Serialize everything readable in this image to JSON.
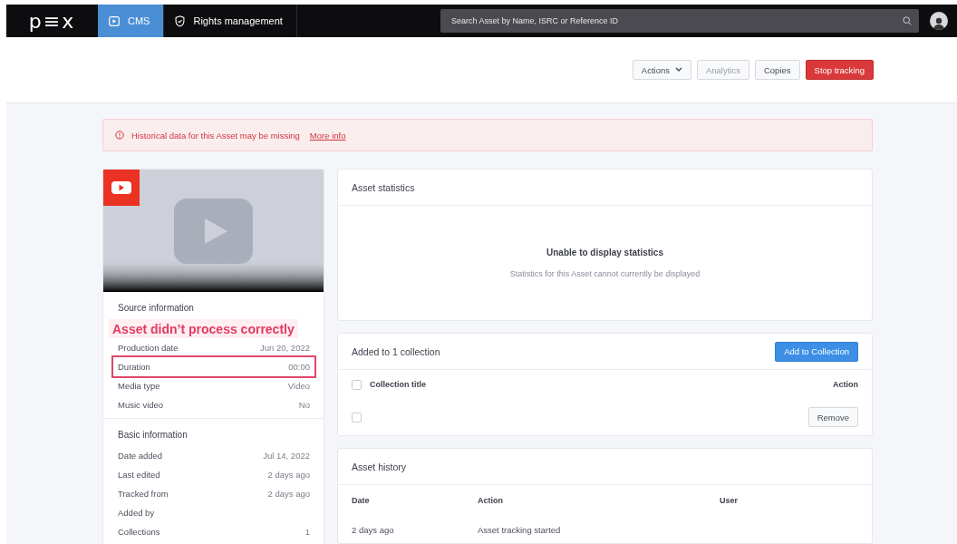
{
  "nav": {
    "logo": "p≡x",
    "tabs": [
      {
        "label": "CMS",
        "selected": true,
        "kind": "play"
      },
      {
        "label": "Rights management",
        "selected": false,
        "kind": "shield"
      }
    ],
    "search": {
      "placeholder": "Search Asset by Name, ISRC or Reference ID"
    }
  },
  "actions": [
    {
      "label": "Actions",
      "kind": "dropdown",
      "disabled": false
    },
    {
      "label": "Analytics",
      "kind": "default",
      "disabled": true
    },
    {
      "label": "Copies",
      "kind": "default",
      "disabled": false
    },
    {
      "label": "Stop tracking",
      "kind": "danger",
      "disabled": false
    }
  ],
  "alert": {
    "text": "Historical data for this Asset may be missing",
    "link": "More info"
  },
  "sections": [
    {
      "title": "Source information",
      "rows": [
        {
          "label": "Production date",
          "value": "Jun 20, 2022",
          "highlighted": false
        },
        {
          "label": "Duration",
          "value": "00:00",
          "highlighted": true
        },
        {
          "label": "Media type",
          "value": "Video",
          "highlighted": false
        },
        {
          "label": "Music video",
          "value": "No",
          "highlighted": false
        }
      ]
    },
    {
      "title": "Basic information",
      "rows": [
        {
          "label": "Date added",
          "value": "Jul 14, 2022",
          "highlighted": false
        },
        {
          "label": "Last edited",
          "value": "2 days ago",
          "highlighted": false
        },
        {
          "label": "Tracked from",
          "value": "2 days ago",
          "highlighted": false
        },
        {
          "label": "Added by",
          "highlighted": false
        },
        {
          "label": "Collections",
          "value": "1",
          "highlighted": false
        }
      ]
    }
  ],
  "annotation": {
    "text": "Asset didn’t process correctly"
  },
  "statistics": {
    "title": "Asset statistics",
    "message": "Unable to display statistics",
    "detail": "Statistics for this Asset cannot currently be displayed"
  },
  "collections": {
    "title": "Added to 1 collection",
    "button": "Add to Collection",
    "columns": [
      "Collection title",
      "Action"
    ],
    "rows": [
      {
        "checked": false,
        "action": "Remove"
      }
    ],
    "header_checked": false
  },
  "history": {
    "title": "Asset history",
    "columns": [
      "Date",
      "Action",
      "User"
    ],
    "rows": [
      {
        "date": "2 days ago",
        "action": "Asset tracking started"
      }
    ]
  }
}
